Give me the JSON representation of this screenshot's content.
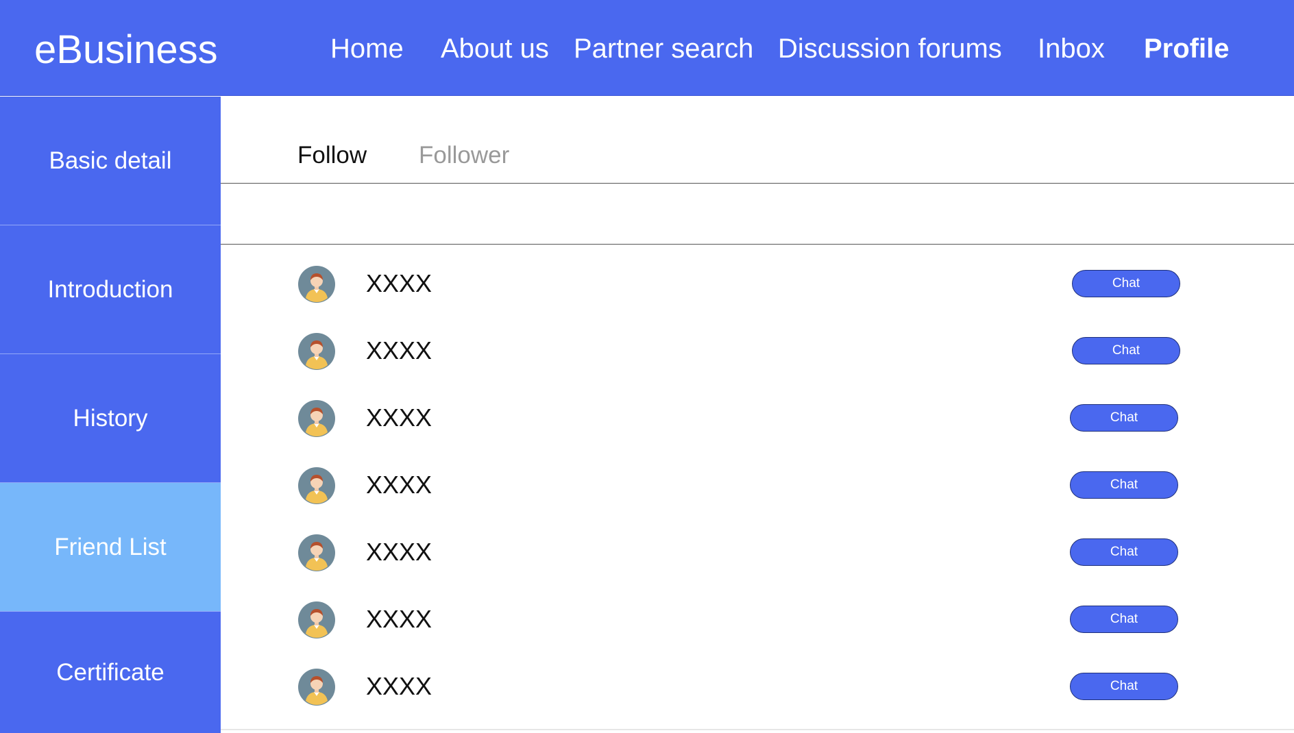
{
  "app": {
    "brand": "eBusiness"
  },
  "nav": {
    "items": [
      {
        "label": "Home"
      },
      {
        "label": "About us"
      },
      {
        "label": "Partner search"
      },
      {
        "label": "Discussion forums"
      },
      {
        "label": "Inbox"
      },
      {
        "label": "Profile",
        "active": true
      }
    ]
  },
  "sidebar": {
    "items": [
      {
        "label": "Basic detail"
      },
      {
        "label": "Introduction"
      },
      {
        "label": "History"
      },
      {
        "label": "Friend List",
        "active": true
      },
      {
        "label": "Certificate"
      }
    ]
  },
  "tabs": [
    {
      "label": "Follow",
      "active": true
    },
    {
      "label": "Follower",
      "active": false
    }
  ],
  "friends": [
    {
      "name": "XXXX",
      "action": "Chat"
    },
    {
      "name": "XXXX",
      "action": "Chat"
    },
    {
      "name": "XXXX",
      "action": "Chat"
    },
    {
      "name": "XXXX",
      "action": "Chat"
    },
    {
      "name": "XXXX",
      "action": "Chat"
    },
    {
      "name": "XXXX",
      "action": "Chat"
    },
    {
      "name": "XXXX",
      "action": "Chat"
    }
  ],
  "icons": {
    "avatar": "user-avatar-icon"
  },
  "colors": {
    "primary": "#4a68ef",
    "sidebar_active": "#77b7fa",
    "tab_inactive": "#999999"
  }
}
